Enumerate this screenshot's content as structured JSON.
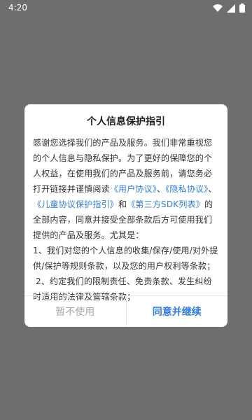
{
  "status_bar": {
    "time": "4:20",
    "icons": [
      "wifi-icon",
      "signal-icon",
      "battery-icon"
    ]
  },
  "dialog": {
    "title": "个人信息保护指引",
    "intro_1": "感谢您选择我们的产品及服务。我们非常重视您的个人信息与隐私保护。为了更好的保障您的个人权益，在使用我们的产品及服务前，请您务必打开链接并谨慎阅读",
    "link_user_agreement": "《用户协议》",
    "sep_1": "、",
    "link_privacy": "《隐私协议》",
    "sep_2": "、",
    "link_child": "《儿童协议保护指引》",
    "sep_3": "和",
    "link_sdk": "《第三方SDK列表》",
    "intro_2": "的全部内容，同意并接受全部条款后方可使用我们提供的产品及服务。尤其是：",
    "item_1": "1、我们对您的个人信息的收集/保存/使用/对外提供/保护等规则条款，以及您的用户权利等条款；",
    "item_2": " 2、约定我们的限制责任、免责条款、发生纠纷时适用的法律及管辖条款；",
    "disagree_label": "暂不使用",
    "agree_label": "同意并继续"
  },
  "colors": {
    "accent": "#2f7de1",
    "overlay": "#6e6e6e",
    "disabled_text": "#a9a9a9"
  }
}
